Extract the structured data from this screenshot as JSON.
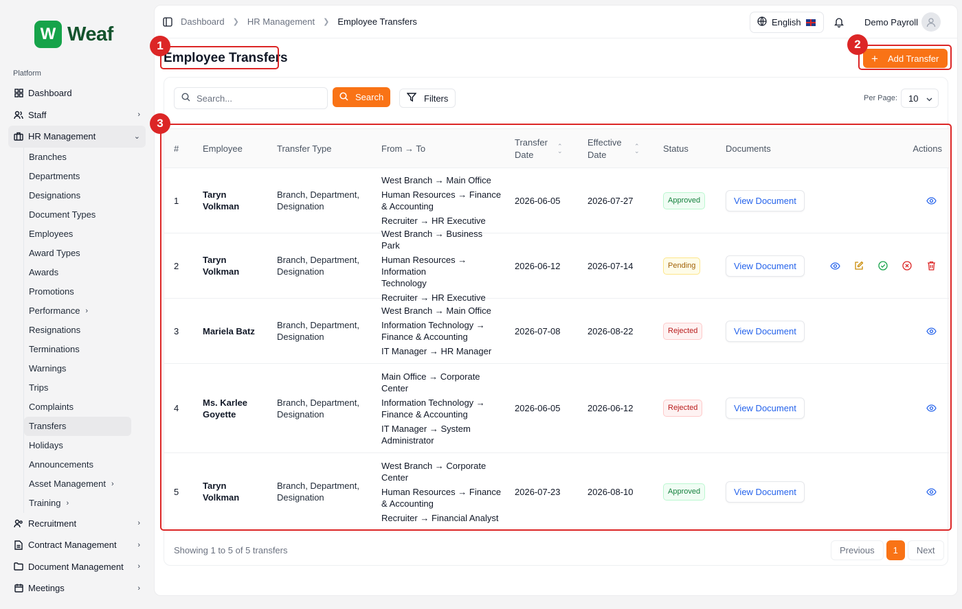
{
  "brand": {
    "name": "Weaf",
    "mark": "W"
  },
  "sidebar": {
    "section_label": "Platform",
    "items": [
      {
        "label": "Dashboard",
        "icon": "grid-icon"
      },
      {
        "label": "Staff",
        "icon": "users-icon"
      },
      {
        "label": "HR Management",
        "icon": "briefcase-icon"
      }
    ],
    "hr_sub": [
      {
        "label": "Branches"
      },
      {
        "label": "Departments"
      },
      {
        "label": "Designations"
      },
      {
        "label": "Document Types"
      },
      {
        "label": "Employees"
      },
      {
        "label": "Award Types"
      },
      {
        "label": "Awards"
      },
      {
        "label": "Promotions"
      },
      {
        "label": "Performance"
      },
      {
        "label": "Resignations"
      },
      {
        "label": "Terminations"
      },
      {
        "label": "Warnings"
      },
      {
        "label": "Trips"
      },
      {
        "label": "Complaints"
      },
      {
        "label": "Transfers"
      },
      {
        "label": "Holidays"
      },
      {
        "label": "Announcements"
      },
      {
        "label": "Asset Management"
      },
      {
        "label": "Training"
      }
    ],
    "bottom_items": [
      {
        "label": "Recruitment",
        "icon": "user-search-icon"
      },
      {
        "label": "Contract Management",
        "icon": "file-icon"
      },
      {
        "label": "Document Management",
        "icon": "folder-icon"
      },
      {
        "label": "Meetings",
        "icon": "calendar-icon"
      }
    ]
  },
  "topbar": {
    "breadcrumbs": [
      "Dashboard",
      "HR Management",
      "Employee Transfers"
    ],
    "language": "English",
    "user_name": "Demo Payroll"
  },
  "page": {
    "title": "Employee Transfers",
    "add_button": "Add Transfer"
  },
  "toolbar": {
    "search_placeholder": "Search...",
    "search_button": "Search",
    "filters_button": "Filters",
    "per_page_label": "Per Page:",
    "per_page_value": "10"
  },
  "table": {
    "columns": [
      "#",
      "Employee",
      "Transfer Type",
      "From → To",
      "Transfer Date",
      "Effective Date",
      "Status",
      "Documents",
      "Actions"
    ],
    "rows": [
      {
        "num": "1",
        "employee": "Taryn Volkman",
        "type": "Branch, Department, Designation",
        "moves": [
          "West Branch → Main Office",
          "Human Resources → Finance & Accounting",
          "Recruiter → HR Executive"
        ],
        "transfer_date": "2026-06-05",
        "effective_date": "2026-07-27",
        "status": "Approved",
        "doc": "View Document"
      },
      {
        "num": "2",
        "employee": "Taryn Volkman",
        "type": "Branch, Department, Designation",
        "moves": [
          "West Branch → Business Park",
          "Human Resources → Information Technology",
          "Recruiter → HR Executive"
        ],
        "transfer_date": "2026-06-12",
        "effective_date": "2026-07-14",
        "status": "Pending",
        "doc": "View Document"
      },
      {
        "num": "3",
        "employee": "Mariela Batz",
        "type": "Branch, Department, Designation",
        "moves": [
          "West Branch → Main Office",
          "Information Technology → Finance & Accounting",
          "IT Manager → HR Manager"
        ],
        "transfer_date": "2026-07-08",
        "effective_date": "2026-08-22",
        "status": "Rejected",
        "doc": "View Document"
      },
      {
        "num": "4",
        "employee": "Ms. Karlee Goyette",
        "type": "Branch, Department, Designation",
        "moves": [
          "Main Office → Corporate Center",
          "Information Technology → Finance & Accounting",
          "IT Manager → System Administrator"
        ],
        "transfer_date": "2026-06-05",
        "effective_date": "2026-06-12",
        "status": "Rejected",
        "doc": "View Document"
      },
      {
        "num": "5",
        "employee": "Taryn Volkman",
        "type": "Branch, Department, Designation",
        "moves": [
          "West Branch → Corporate Center",
          "Human Resources → Finance & Accounting",
          "Recruiter → Financial Analyst"
        ],
        "transfer_date": "2026-07-23",
        "effective_date": "2026-08-10",
        "status": "Approved",
        "doc": "View Document"
      }
    ]
  },
  "footer": {
    "summary": "Showing 1 to 5 of 5 transfers",
    "prev": "Previous",
    "page": "1",
    "next": "Next"
  },
  "annotations": [
    "1",
    "2",
    "3"
  ],
  "colors": {
    "accent": "#f97316",
    "brand": "#16a34a",
    "highlight": "#dc2626"
  }
}
